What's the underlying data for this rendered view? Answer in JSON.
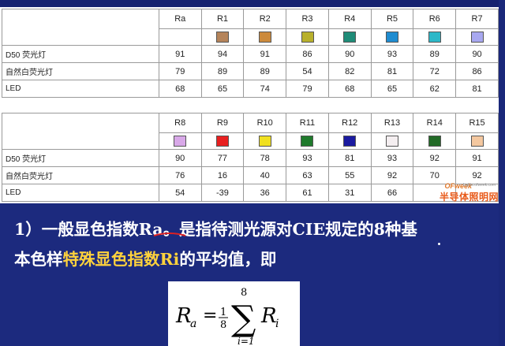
{
  "table1": {
    "headers": [
      "Ra",
      "R1",
      "R2",
      "R3",
      "R4",
      "R5",
      "R6",
      "R7"
    ],
    "swatches": [
      "#b5845a",
      "#cc8a3c",
      "#b8b02c",
      "#1f8c78",
      "#1f8cd0",
      "#2cb8c8",
      "#a8a8f0"
    ],
    "rows": [
      {
        "label": "D50 荧光灯",
        "values": [
          "91",
          "94",
          "91",
          "86",
          "90",
          "93",
          "89",
          "90"
        ]
      },
      {
        "label": "自然白荧光灯",
        "values": [
          "79",
          "89",
          "89",
          "54",
          "82",
          "81",
          "72",
          "86"
        ]
      },
      {
        "label": "LED",
        "values": [
          "68",
          "65",
          "74",
          "79",
          "68",
          "65",
          "62",
          "81"
        ]
      }
    ]
  },
  "table2": {
    "headers": [
      "R8",
      "R9",
      "R10",
      "R11",
      "R12",
      "R13",
      "R14",
      "R15"
    ],
    "swatches": [
      "#d8a8e8",
      "#e82020",
      "#f0e020",
      "#1f7a2c",
      "#1a1aa0",
      "#f4eef0",
      "#226a26",
      "#f4c8a0"
    ],
    "rows": [
      {
        "label": "D50 荧光灯",
        "values": [
          "90",
          "77",
          "78",
          "93",
          "81",
          "93",
          "92",
          "91"
        ]
      },
      {
        "label": "自然白荧光灯",
        "values": [
          "76",
          "16",
          "40",
          "63",
          "55",
          "92",
          "70",
          "92"
        ]
      },
      {
        "label": "LED",
        "values": [
          "54",
          "-39",
          "36",
          "61",
          "31",
          "66",
          "",
          ""
        ]
      }
    ]
  },
  "watermark": {
    "logo": "OFweek",
    "url": "Lights.ofweek.com",
    "text": "半导体照明网"
  },
  "paragraph": {
    "line1_a": "1）一般显色指数",
    "line1_b": "Ra",
    "line1_c": "。是指待测光源对CIE规定的8种基",
    "line2_a": "本色样",
    "line2_b": "特殊显色指数Ri",
    "line2_c": "的平均值，即"
  },
  "formula": {
    "lhs": "R",
    "lhs_sub": "a",
    "num": "1",
    "den": "8",
    "sum_top": "8",
    "sum_bottom": "i=1",
    "rhs": "R",
    "rhs_sub": "i"
  },
  "colors": {
    "background": "#1c2a7e",
    "highlight_yellow": "#ffd23c",
    "underline_red": "#e02020"
  }
}
